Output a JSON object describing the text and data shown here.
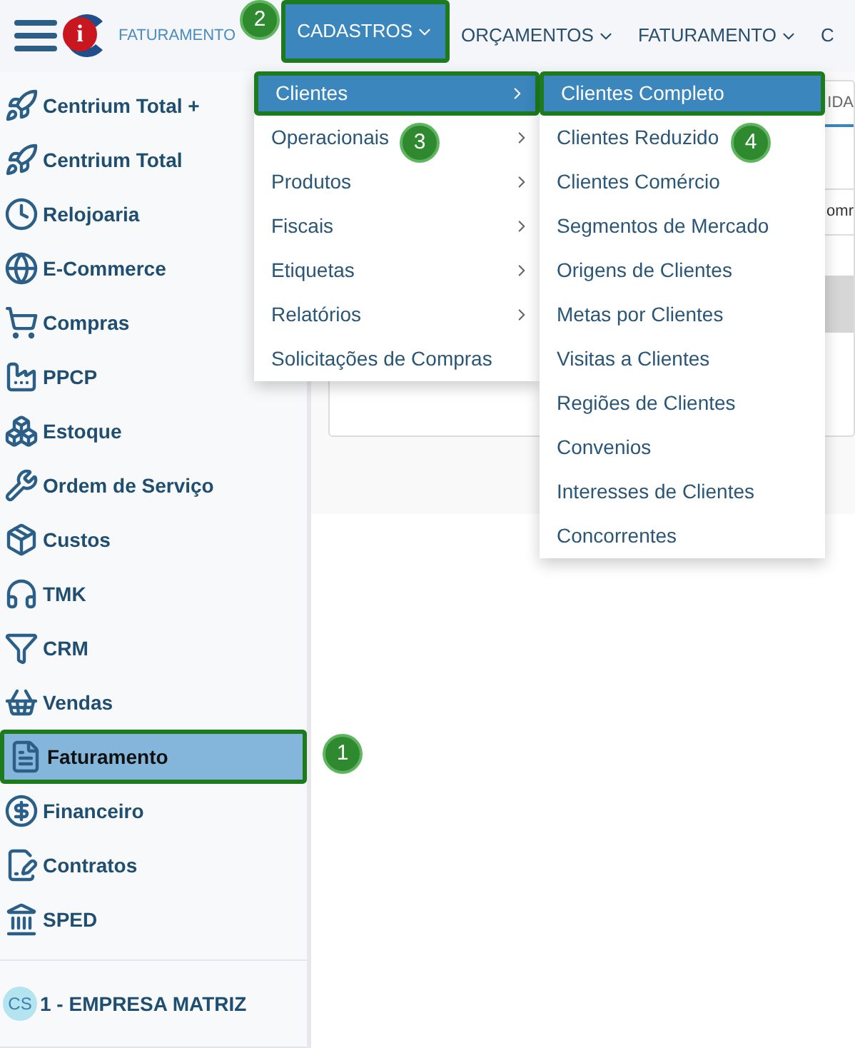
{
  "header": {
    "logo_badge": "i",
    "module": "FATURAMENTO",
    "nav": [
      {
        "label": "CADASTROS",
        "selected": true,
        "highlighted": true,
        "caret": true
      },
      {
        "label": "ORÇAMENTOS",
        "selected": false,
        "highlighted": false,
        "caret": true
      },
      {
        "label": "FATURAMENTO",
        "selected": false,
        "highlighted": false,
        "caret": true
      },
      {
        "label": "C",
        "selected": false,
        "highlighted": false,
        "caret": false
      }
    ]
  },
  "sidebar": {
    "items": [
      {
        "label": "Centrium Total +",
        "selected": false,
        "highlighted": false
      },
      {
        "label": "Centrium Total",
        "selected": false,
        "highlighted": false
      },
      {
        "label": "Relojoaria",
        "selected": false,
        "highlighted": false
      },
      {
        "label": "E-Commerce",
        "selected": false,
        "highlighted": false
      },
      {
        "label": "Compras",
        "selected": false,
        "highlighted": false
      },
      {
        "label": "PPCP",
        "selected": false,
        "highlighted": false
      },
      {
        "label": "Estoque",
        "selected": false,
        "highlighted": false
      },
      {
        "label": "Ordem de Serviço",
        "selected": false,
        "highlighted": false
      },
      {
        "label": "Custos",
        "selected": false,
        "highlighted": false
      },
      {
        "label": "TMK",
        "selected": false,
        "highlighted": false
      },
      {
        "label": "CRM",
        "selected": false,
        "highlighted": false
      },
      {
        "label": "Vendas",
        "selected": false,
        "highlighted": false
      },
      {
        "label": "Faturamento",
        "selected": true,
        "highlighted": true
      },
      {
        "label": "Financeiro",
        "selected": false,
        "highlighted": false
      },
      {
        "label": "Contratos",
        "selected": false,
        "highlighted": false
      },
      {
        "label": "SPED",
        "selected": false,
        "highlighted": false
      }
    ],
    "company": {
      "avatar": "CS",
      "name": "1 - EMPRESA MATRIZ"
    }
  },
  "background": {
    "fragments": [
      "IDA",
      "omr"
    ]
  },
  "menu": {
    "items": [
      {
        "label": "Clientes",
        "submenu": true,
        "selected": true,
        "highlighted": true
      },
      {
        "label": "Operacionais",
        "submenu": true,
        "selected": false,
        "highlighted": false
      },
      {
        "label": "Produtos",
        "submenu": true,
        "selected": false,
        "highlighted": false
      },
      {
        "label": "Fiscais",
        "submenu": true,
        "selected": false,
        "highlighted": false
      },
      {
        "label": "Etiquetas",
        "submenu": true,
        "selected": false,
        "highlighted": false
      },
      {
        "label": "Relatórios",
        "submenu": true,
        "selected": false,
        "highlighted": false
      },
      {
        "label": "Solicitações de Compras",
        "submenu": false,
        "selected": false,
        "highlighted": false
      }
    ]
  },
  "submenu": {
    "items": [
      {
        "label": "Clientes Completo",
        "selected": true,
        "highlighted": true
      },
      {
        "label": "Clientes Reduzido",
        "selected": false,
        "highlighted": false
      },
      {
        "label": "Clientes Comércio",
        "selected": false,
        "highlighted": false
      },
      {
        "label": "Segmentos de Mercado",
        "selected": false,
        "highlighted": false
      },
      {
        "label": "Origens de Clientes",
        "selected": false,
        "highlighted": false
      },
      {
        "label": "Metas por Clientes",
        "selected": false,
        "highlighted": false
      },
      {
        "label": "Visitas a Clientes",
        "selected": false,
        "highlighted": false
      },
      {
        "label": "Regiões de Clientes",
        "selected": false,
        "highlighted": false
      },
      {
        "label": "Convenios",
        "selected": false,
        "highlighted": false
      },
      {
        "label": "Interesses de Clientes",
        "selected": false,
        "highlighted": false
      },
      {
        "label": "Concorrentes",
        "selected": false,
        "highlighted": false
      }
    ]
  },
  "step_markers": [
    {
      "label": "1"
    },
    {
      "label": "2"
    },
    {
      "label": "3"
    },
    {
      "label": "4"
    }
  ]
}
